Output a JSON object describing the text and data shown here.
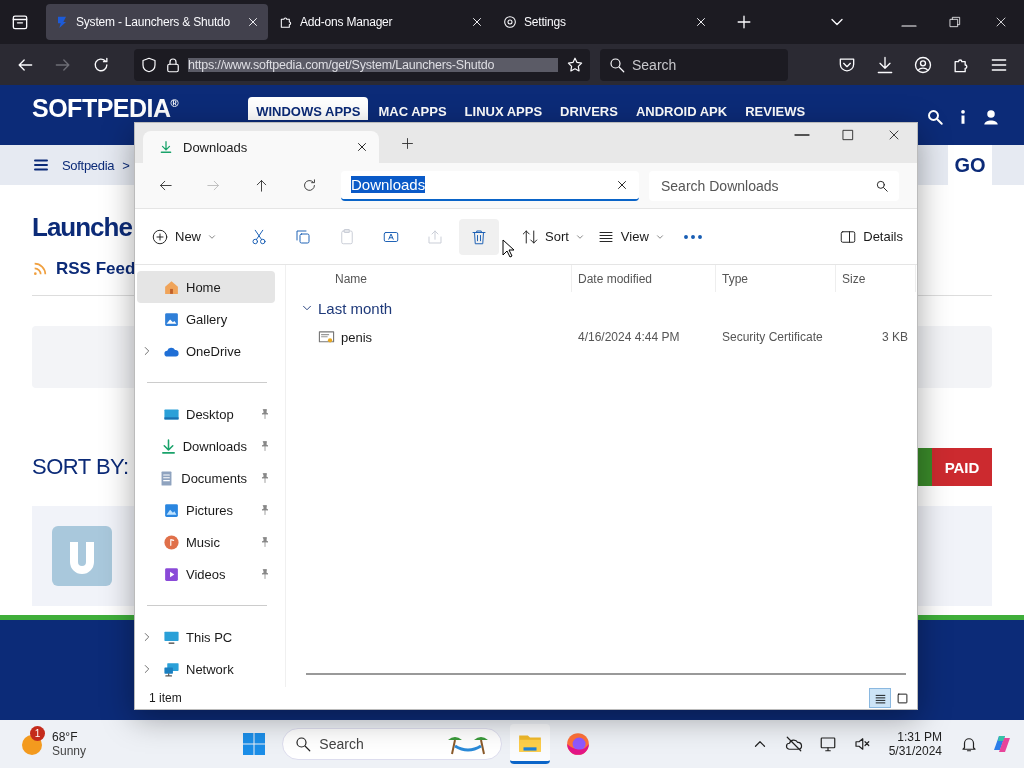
{
  "browser": {
    "tabs": [
      {
        "kind": "site",
        "title": "System - Launchers & Shutdo",
        "selected": true
      },
      {
        "kind": "addons",
        "title": "Add-ons Manager",
        "selected": false
      },
      {
        "kind": "settings",
        "title": "Settings",
        "selected": false
      }
    ],
    "url": "https://www.softpedia.com/get/System/Launchers-Shutdo",
    "search": {
      "placeholder": "Search"
    }
  },
  "site": {
    "logo": "SOFTPEDIA",
    "logo_mark": "®",
    "nav": [
      {
        "label": "WINDOWS APPS",
        "selected": true
      },
      {
        "label": "MAC APPS",
        "selected": false
      },
      {
        "label": "LINUX APPS",
        "selected": false
      },
      {
        "label": "DRIVERS",
        "selected": false
      },
      {
        "label": "ANDROID APK",
        "selected": false
      },
      {
        "label": "REVIEWS",
        "selected": false
      }
    ],
    "breadcrumb": "Softpedia",
    "breadcrumb_separator": ">",
    "go": "GO",
    "heading": "Launche",
    "rss": "RSS Feed",
    "sort_by": "SORT BY:",
    "filter": "PAID"
  },
  "explorer": {
    "tab": "Downloads",
    "address": "Downloads",
    "search": {
      "placeholder": "Search Downloads"
    },
    "toolbar": [
      {
        "kind": "new",
        "label": "New",
        "disabled": false
      },
      {
        "kind": "cut",
        "disabled": false
      },
      {
        "kind": "copy",
        "disabled": false
      },
      {
        "kind": "paste",
        "disabled": true
      },
      {
        "kind": "rename",
        "disabled": false
      },
      {
        "kind": "share",
        "disabled": true
      },
      {
        "kind": "delete",
        "disabled": false
      },
      {
        "kind": "sort",
        "label": "Sort",
        "disabled": false
      },
      {
        "kind": "view",
        "label": "View",
        "disabled": false
      },
      {
        "kind": "more",
        "disabled": false
      }
    ],
    "details": "Details",
    "sidebar": {
      "sections": [
        {
          "items": [
            {
              "kind": "home",
              "label": "Home",
              "selected": true,
              "expandable": false,
              "pinned": false
            },
            {
              "kind": "gallery",
              "label": "Gallery",
              "selected": false,
              "expandable": false,
              "pinned": false
            },
            {
              "kind": "cloud",
              "label": "OneDrive",
              "selected": false,
              "expandable": true,
              "pinned": false
            }
          ]
        },
        {
          "items": [
            {
              "kind": "desktop",
              "label": "Desktop",
              "selected": false,
              "expandable": false,
              "pinned": true
            },
            {
              "kind": "download",
              "label": "Downloads",
              "selected": false,
              "expandable": false,
              "pinned": true
            },
            {
              "kind": "documents",
              "label": "Documents",
              "selected": false,
              "expandable": false,
              "pinned": true
            },
            {
              "kind": "pictures",
              "label": "Pictures",
              "selected": false,
              "expandable": false,
              "pinned": true
            },
            {
              "kind": "music",
              "label": "Music",
              "selected": false,
              "expandable": false,
              "pinned": true
            },
            {
              "kind": "videos",
              "label": "Videos",
              "selected": false,
              "expandable": false,
              "pinned": true
            }
          ]
        },
        {
          "items": [
            {
              "kind": "pc",
              "label": "This PC",
              "selected": false,
              "expandable": true,
              "pinned": false
            },
            {
              "kind": "network",
              "label": "Network",
              "selected": false,
              "expandable": true,
              "pinned": false
            }
          ]
        }
      ]
    },
    "columns": [
      "Name",
      "Date modified",
      "Type",
      "Size"
    ],
    "groups": [
      {
        "label": "Last month",
        "expanded": true,
        "rows": [
          {
            "name": "penis",
            "date": "4/16/2024 4:44 PM",
            "type": "Security Certificate",
            "size": "3 KB",
            "selected": false
          }
        ]
      }
    ],
    "status": "1 item",
    "view_modes": [
      {
        "kind": "details",
        "selected": true
      },
      {
        "kind": "tiles",
        "selected": false
      }
    ]
  },
  "taskbar": {
    "weather": {
      "temp": "68°F",
      "condition": "Sunny",
      "badge": "1"
    },
    "search": {
      "placeholder": "Search"
    },
    "time": "1:31 PM",
    "date": "5/31/2024"
  }
}
